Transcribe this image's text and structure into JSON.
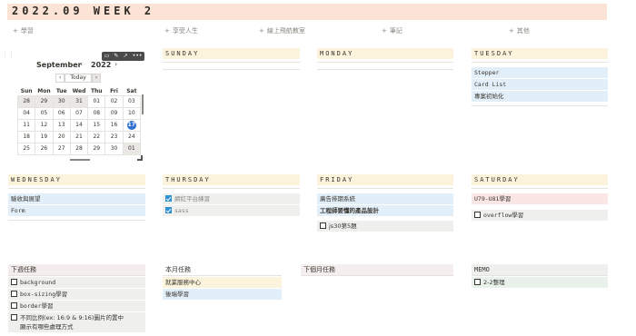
{
  "title": "2022.09 WEEK 2",
  "add_links": [
    "學習",
    "享受人生",
    "線上飛航教室",
    "筆記",
    "其他"
  ],
  "calendar": {
    "toolbar_icons": [
      "comment-icon",
      "edit-icon",
      "open-icon",
      "more-icon"
    ],
    "toolbar_glyphs": [
      "▭",
      "✎",
      "↗",
      "•••"
    ],
    "month": "September",
    "year": "2022",
    "prev": "‹",
    "next": "›",
    "today_label": "Today",
    "nav_prev": "‹",
    "nav_next": "›",
    "weekdays": [
      "Sun",
      "Mon",
      "Tue",
      "Wed",
      "Thu",
      "Fri",
      "Sat"
    ],
    "weeks": [
      [
        "28",
        "29",
        "30",
        "31",
        "01",
        "02",
        "03"
      ],
      [
        "04",
        "05",
        "06",
        "07",
        "08",
        "09",
        "10"
      ],
      [
        "11",
        "12",
        "13",
        "14",
        "15",
        "16",
        "17"
      ],
      [
        "18",
        "19",
        "20",
        "21",
        "22",
        "23",
        "24"
      ],
      [
        "25",
        "26",
        "27",
        "28",
        "29",
        "30",
        "01"
      ]
    ],
    "today": "17"
  },
  "days": {
    "sunday": {
      "label": "SUNDAY",
      "items": []
    },
    "monday": {
      "label": "MONDAY",
      "items": []
    },
    "tuesday": {
      "label": "TUESDAY",
      "items": [
        "Stepper",
        "Card List",
        "專案初始化"
      ]
    },
    "wednesday": {
      "label": "WEDNESDAY",
      "items": [
        "驗收與展望",
        "Form"
      ]
    },
    "thursday": {
      "label": "THURSDAY",
      "todos": [
        {
          "text": "網紅平台練習",
          "checked": true
        },
        {
          "text": "sass",
          "checked": true
        }
      ]
    },
    "friday": {
      "label": "FRIDAY",
      "items": [
        "廣告排期系統",
        "工程師要懂的產品設計"
      ],
      "todos": [
        {
          "text": "js30第5題",
          "checked": false
        }
      ]
    },
    "saturday": {
      "label": "SATURDAY",
      "items": [
        "U79-U81學習"
      ],
      "todos": [
        {
          "text": "overflow學習",
          "checked": false
        }
      ]
    }
  },
  "next_week": {
    "label": "下週任務",
    "todos": [
      {
        "text": "background",
        "checked": false
      },
      {
        "text": "box-sizing學習",
        "checked": false
      },
      {
        "text": "border學習",
        "checked": false
      },
      {
        "text": "不同比例(ex: 16:9 & 9:16)圖片的置中",
        "text2": "顯示有哪些處理方式",
        "checked": false
      }
    ]
  },
  "this_month": {
    "label": "本月任務",
    "items": [
      "就業服務中心",
      "後端學習"
    ]
  },
  "next_month": {
    "label": "下個月任務"
  },
  "memo": {
    "label": "MEMO",
    "todos": [
      {
        "text": "2-2整理",
        "checked": false
      }
    ]
  },
  "colors": {
    "title_bg": "#fbe4d6",
    "today_circle": "#2f6fd1",
    "checkbox_on": "#2e8fd1"
  }
}
